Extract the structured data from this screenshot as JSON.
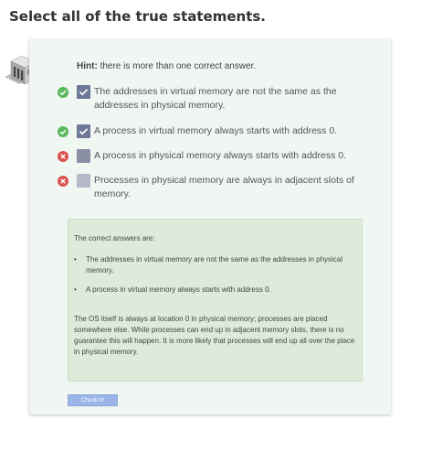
{
  "question": {
    "title": "Select all of the true statements."
  },
  "hint": {
    "label": "Hint:",
    "text": "there is more than one correct answer."
  },
  "options": [
    {
      "text": "The addresses in virtual memory are not the same as the addresses in physical memory.",
      "checked": true,
      "result": "correct",
      "result_icon": "check-circle-icon"
    },
    {
      "text": "A process in virtual memory always starts with address 0.",
      "checked": true,
      "result": "correct",
      "result_icon": "check-circle-icon"
    },
    {
      "text": "A process in physical memory always starts with address 0.",
      "checked": false,
      "result": "incorrect",
      "result_icon": "x-circle-icon"
    },
    {
      "text": "Processes in physical memory are always in adjacent slots of memory.",
      "checked": false,
      "result": "incorrect",
      "result_icon": "x-circle-icon"
    }
  ],
  "feedback": {
    "heading": "The correct answers are:",
    "answers": [
      "The addresses in virtual memory are not the same as the addresses in physical memory.",
      "A process in virtual memory always starts with address 0."
    ],
    "explanation": "The OS itself is always at location 0 in physical memory; processes are placed somewhere else. While processes can end up in adjacent memory slots, there is no guarantee this will happen. It is more likely that processes will end up all over the place in physical memory."
  },
  "check_button": {
    "label": "Check It!"
  },
  "colors": {
    "correct": "#5cb85c",
    "incorrect": "#d9534f",
    "checkbox_checked": "#6e7896",
    "checkbox_unchecked_dark": "#8a8fa3",
    "checkbox_unchecked_light": "#b4b8c8",
    "card_background": "#f0f6f1",
    "feedback_background": "#ddebdb",
    "button_background": "#9ab5e6"
  }
}
